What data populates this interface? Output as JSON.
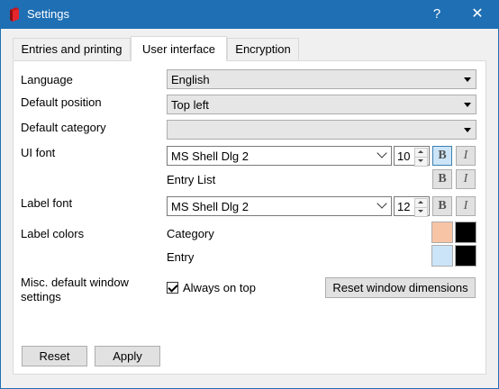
{
  "window": {
    "title": "Settings",
    "help_glyph": "?",
    "close_glyph": "✕"
  },
  "tabs": [
    {
      "label": "Entries and printing",
      "active": false
    },
    {
      "label": "User interface",
      "active": true
    },
    {
      "label": "Encryption",
      "active": false
    }
  ],
  "ui": {
    "language": {
      "label": "Language",
      "value": "English"
    },
    "default_position": {
      "label": "Default position",
      "value": "Top left"
    },
    "default_category": {
      "label": "Default category",
      "value": ""
    },
    "ui_font": {
      "label": "UI font",
      "family": "MS Shell Dlg 2",
      "size": "10",
      "bold": true,
      "italic": false,
      "preview_text": "Entry List"
    },
    "label_font": {
      "label": "Label font",
      "family": "MS Shell Dlg 2",
      "size": "12",
      "bold": false,
      "italic": false
    },
    "label_colors": {
      "label": "Label colors",
      "category": {
        "label": "Category",
        "background": "#f7c4a5",
        "foreground": "#000000"
      },
      "entry": {
        "label": "Entry",
        "background": "#cce4f7",
        "foreground": "#000000"
      }
    },
    "misc": {
      "label": "Misc. default window settings",
      "always_on_top": {
        "label": "Always on top",
        "checked": true
      },
      "reset_dimensions_label": "Reset window dimensions"
    },
    "bold_glyph": "B",
    "italic_glyph": "I"
  },
  "footer": {
    "reset_label": "Reset",
    "apply_label": "Apply"
  },
  "colors": {
    "titlebar": "#1f6fb4",
    "tab_panel": "#ffffff",
    "dialog": "#f0f0f0"
  }
}
